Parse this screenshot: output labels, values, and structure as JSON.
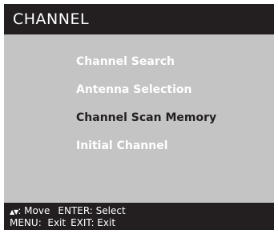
{
  "header": {
    "title": "CHANNEL"
  },
  "menu": {
    "selected_index": 2,
    "items": [
      {
        "label": "Channel Search"
      },
      {
        "label": "Antenna Selection"
      },
      {
        "label": "Channel Scan Memory"
      },
      {
        "label": "Initial Channel"
      }
    ]
  },
  "footer": {
    "move_icon": "▲▼",
    "move_label": ": Move",
    "enter_label": "ENTER: Select",
    "menu_label": "MENU:  Exit",
    "exit_label": "EXIT: Exit"
  },
  "colors": {
    "bar_background": "#231f20",
    "panel_background": "#c4c4c4",
    "item_text": "#ffffff",
    "selected_item_text": "#231f20"
  }
}
